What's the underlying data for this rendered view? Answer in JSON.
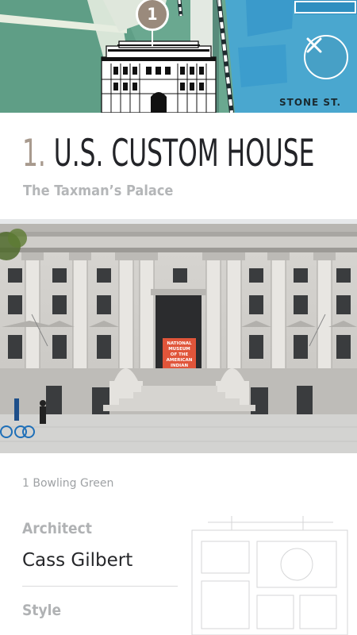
{
  "header": {
    "pin_number": "1",
    "street_label": "STONE ST.",
    "close_icon": "close-icon",
    "colors": {
      "park": "#6aa890",
      "water": "#4aa7cf",
      "pin": "#9a8a7c"
    }
  },
  "site": {
    "number": "1.",
    "name": "U.S. CUSTOM HOUSE",
    "nickname": "The Taxman’s Palace",
    "photo_sign": [
      "NATIONAL",
      "MUSEUM",
      "OF THE",
      "AMERICAN",
      "INDIAN"
    ],
    "address": "1 Bowling Green"
  },
  "details": [
    {
      "label": "Architect",
      "value": "Cass Gilbert"
    },
    {
      "label": "Style",
      "value": ""
    }
  ]
}
